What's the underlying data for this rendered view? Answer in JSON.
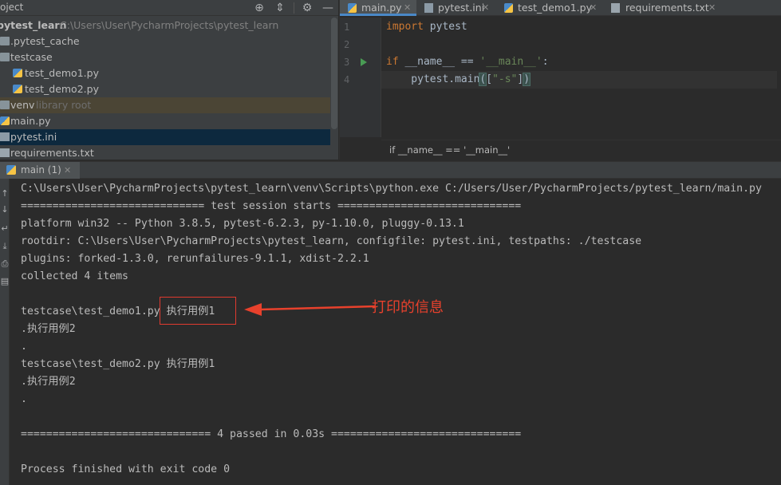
{
  "project_panel": {
    "title": "oject",
    "tree": [
      {
        "name": "pytest_learn",
        "path": "C:\\Users\\User\\PycharmProjects\\pytest_learn",
        "type": "root"
      },
      {
        "name": ".pytest_cache",
        "type": "folder"
      },
      {
        "name": "testcase",
        "type": "folder"
      },
      {
        "name": "test_demo1.py",
        "type": "py"
      },
      {
        "name": "test_demo2.py",
        "type": "py"
      },
      {
        "name": "venv",
        "suffix": "library root",
        "type": "folder"
      },
      {
        "name": "main.py",
        "type": "py"
      },
      {
        "name": "pytest.ini",
        "type": "ini",
        "selected": true
      },
      {
        "name": "requirements.txt",
        "type": "txt"
      }
    ]
  },
  "editor": {
    "tabs": [
      {
        "label": "main.py",
        "active": true
      },
      {
        "label": "pytest.ini"
      },
      {
        "label": "test_demo1.py"
      },
      {
        "label": "requirements.txt"
      }
    ],
    "line_numbers": [
      "1",
      "2",
      "3",
      "4"
    ],
    "code": {
      "l1_kw": "import",
      "l1_rest": " pytest",
      "l3_kw": "if",
      "l3_mid": " __name__ == ",
      "l3_str": "'__main__'",
      "l3_end": ":",
      "l4_pre": "    pytest.main",
      "l4_open": "(",
      "l4_lb": "[",
      "l4_str": "\"-s\"",
      "l4_rb": "]",
      "l4_close": ")"
    },
    "breadcrumb": "if __name__ == '__main__'"
  },
  "run_panel": {
    "tab_label": "main (1)",
    "console_lines": [
      "C:\\Users\\User\\PycharmProjects\\pytest_learn\\venv\\Scripts\\python.exe C:/Users/User/PycharmProjects/pytest_learn/main.py",
      "============================= test session starts =============================",
      "platform win32 -- Python 3.8.5, pytest-6.2.3, py-1.10.0, pluggy-0.13.1",
      "rootdir: C:\\Users\\User\\PycharmProjects\\pytest_learn, configfile: pytest.ini, testpaths: ./testcase",
      "plugins: forked-1.3.0, rerunfailures-9.1.1, xdist-2.2.1",
      "collected 4 items",
      "",
      "testcase\\test_demo1.py 执行用例1",
      ".执行用例2",
      ".",
      "testcase\\test_demo2.py 执行用例1",
      ".执行用例2",
      ".",
      "",
      "============================== 4 passed in 0.03s ==============================",
      "",
      "Process finished with exit code 0"
    ],
    "annotation": "打印的信息"
  },
  "colors": {
    "annotation_red": "#e8412c",
    "keyword": "#cc7832",
    "string": "#6a8759",
    "selection": "#0d293e"
  }
}
